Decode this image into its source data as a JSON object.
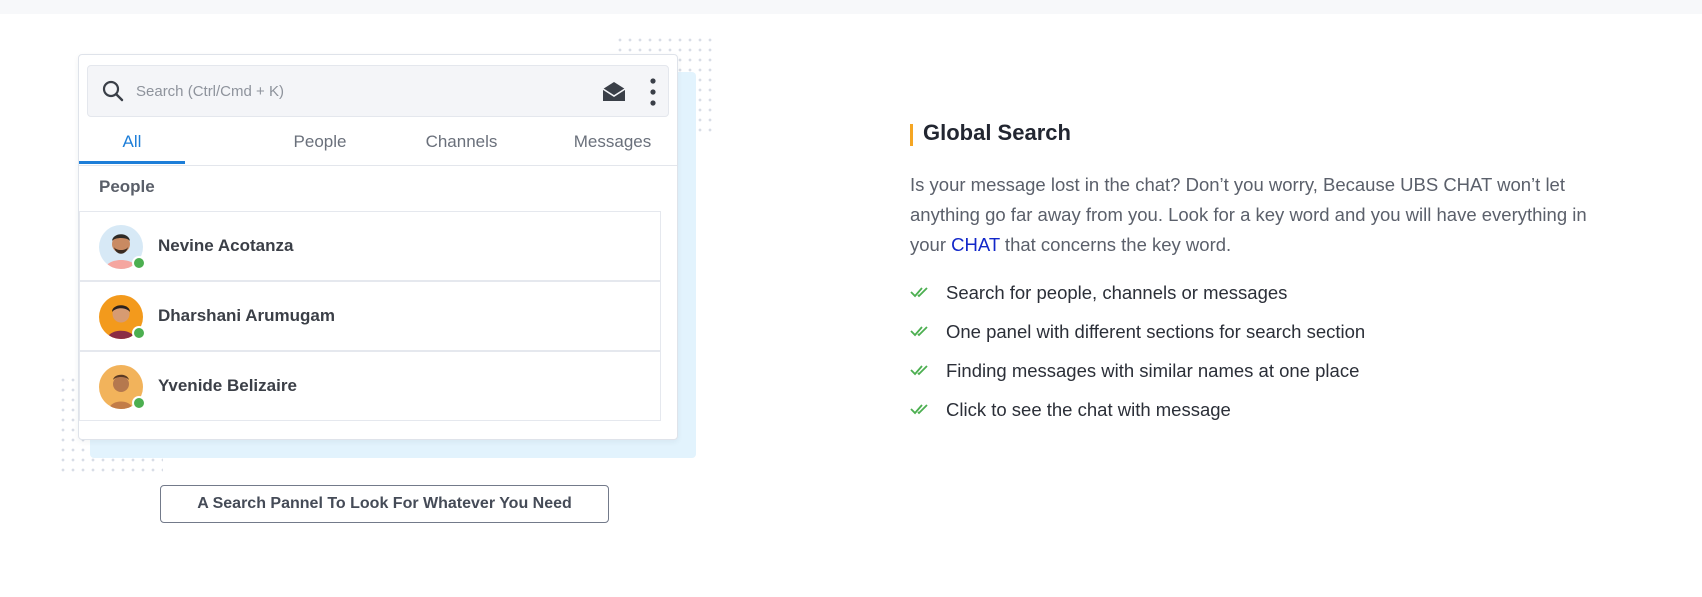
{
  "search_panel": {
    "search": {
      "placeholder": "Search (Ctrl/Cmd + K)"
    },
    "tabs": [
      {
        "label": "All",
        "active": true
      },
      {
        "label": "People",
        "active": false
      },
      {
        "label": "Channels",
        "active": false
      },
      {
        "label": "Messages",
        "active": false
      }
    ],
    "section_label": "People",
    "people": [
      {
        "name": "Nevine Acotanza",
        "online": true
      },
      {
        "name": "Dharshani Arumugam",
        "online": true
      },
      {
        "name": "Yvenide Belizaire",
        "online": true
      }
    ],
    "icons": [
      "search-icon",
      "mail-icon",
      "kebab-menu-icon"
    ]
  },
  "caption": "A Search Pannel To Look For Whatever You Need",
  "feature": {
    "title": "Global Search",
    "description_before": "Is your message lost in the chat? Don’t you worry, Because UBS CHAT won’t let anything go far away from you. Look for a key word and you will have everything in your ",
    "description_highlight": "CHAT",
    "description_after": " that concerns the key word.",
    "bullets": [
      "Search for people, channels or messages",
      "One panel with different sections for search section",
      "Finding messages with similar names at one place",
      "Click to see the chat with message"
    ]
  },
  "colors": {
    "accent_blue": "#1d7ed8",
    "heading_bar": "#f5a623",
    "online_green": "#4caf50",
    "check_green": "#4caf50",
    "highlight_link": "#1227c9"
  }
}
